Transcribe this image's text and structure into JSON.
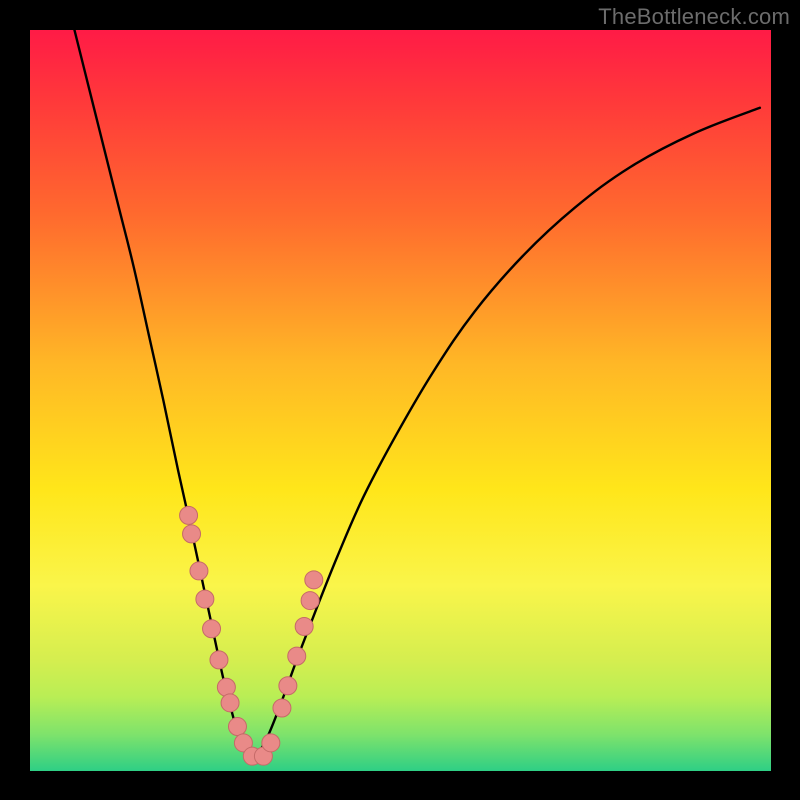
{
  "watermark": {
    "text": "TheBottleneck.com"
  },
  "chart_data": {
    "type": "line",
    "title": "",
    "xlabel": "",
    "ylabel": "",
    "xlim": [
      0,
      1
    ],
    "ylim": [
      0,
      1
    ],
    "notes": "Decorative bottleneck curve on a red→green vertical gradient. Two black curves descend from the top edge, meet near x≈0.30 at the bottom (y≈0). Pink dot markers cluster along both curves in the lower region.",
    "series": [
      {
        "name": "left-curve",
        "x": [
          0.06,
          0.08,
          0.1,
          0.12,
          0.14,
          0.16,
          0.18,
          0.2,
          0.22,
          0.235,
          0.25,
          0.262,
          0.275,
          0.285,
          0.3
        ],
        "y": [
          1.0,
          0.92,
          0.84,
          0.76,
          0.68,
          0.59,
          0.5,
          0.405,
          0.315,
          0.245,
          0.175,
          0.12,
          0.07,
          0.035,
          0.01
        ]
      },
      {
        "name": "right-curve",
        "x": [
          0.3,
          0.32,
          0.34,
          0.36,
          0.385,
          0.415,
          0.45,
          0.495,
          0.545,
          0.6,
          0.665,
          0.735,
          0.81,
          0.895,
          0.985
        ],
        "y": [
          0.01,
          0.045,
          0.095,
          0.15,
          0.215,
          0.29,
          0.37,
          0.455,
          0.54,
          0.62,
          0.695,
          0.76,
          0.815,
          0.86,
          0.895
        ]
      },
      {
        "name": "dots",
        "x": [
          0.214,
          0.218,
          0.228,
          0.236,
          0.245,
          0.255,
          0.265,
          0.27,
          0.28,
          0.288,
          0.3,
          0.315,
          0.325,
          0.34,
          0.348,
          0.36,
          0.37,
          0.378,
          0.383
        ],
        "y": [
          0.345,
          0.32,
          0.27,
          0.232,
          0.192,
          0.15,
          0.113,
          0.092,
          0.06,
          0.038,
          0.02,
          0.02,
          0.038,
          0.085,
          0.115,
          0.155,
          0.195,
          0.23,
          0.258
        ]
      }
    ],
    "colors": {
      "curve_stroke": "#000000",
      "dot_fill": "#e98a88",
      "dot_stroke": "#c56a68",
      "gradient_top": "#ff1b46",
      "gradient_bottom": "#2ecf85",
      "frame": "#000000"
    }
  }
}
